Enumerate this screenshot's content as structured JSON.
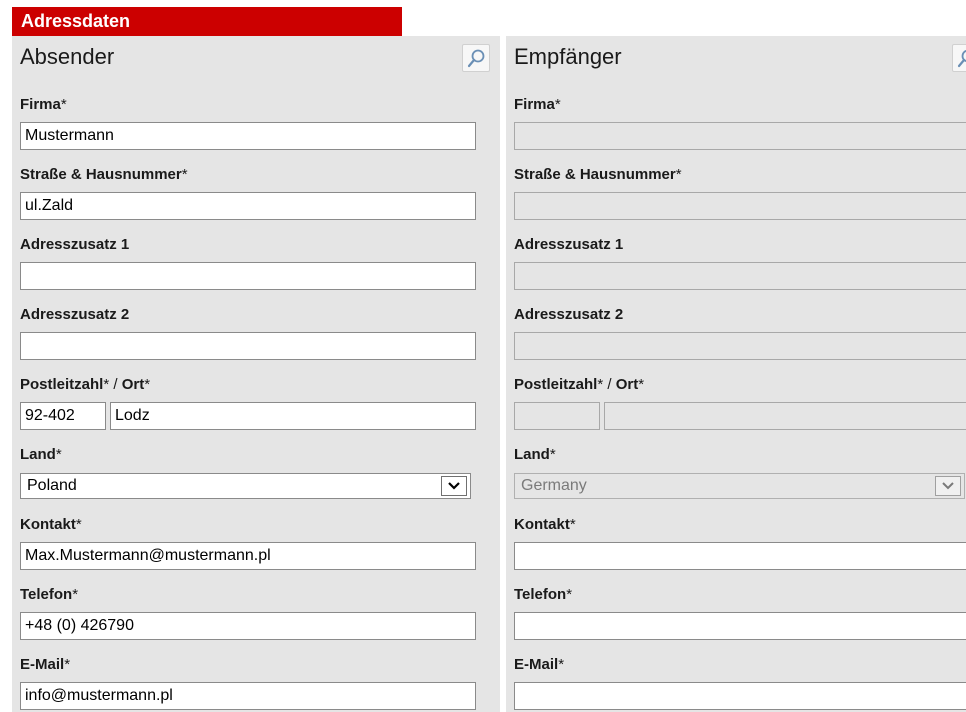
{
  "section_title": "Adressdaten",
  "sender": {
    "title": "Absender",
    "firma_label": "Firma",
    "firma_value": "Mustermann",
    "street_label": "Straße & Hausnummer",
    "street_value": "ul.Zald",
    "addr1_label": "Adresszusatz 1",
    "addr1_value": "",
    "addr2_label": "Adresszusatz 2",
    "addr2_value": "",
    "plz_label": "Postleitzahl",
    "ort_label": "Ort",
    "plz_value": "92-402",
    "ort_value": "Lodz",
    "land_label": "Land",
    "land_value": "Poland",
    "contact_label": "Kontakt",
    "contact_value": "Max.Mustermann@mustermann.pl",
    "phone_label": "Telefon",
    "phone_value": "+48 (0) 426790",
    "email_label": "E-Mail",
    "email_value": "info@mustermann.pl"
  },
  "recipient": {
    "title": "Empfänger",
    "firma_label": "Firma",
    "firma_value": "",
    "street_label": "Straße & Hausnummer",
    "street_value": "",
    "addr1_label": "Adresszusatz 1",
    "addr1_value": "",
    "addr2_label": "Adresszusatz 2",
    "addr2_value": "",
    "plz_label": "Postleitzahl",
    "ort_label": "Ort",
    "plz_value": "",
    "ort_value": "",
    "land_label": "Land",
    "land_value": "Germany",
    "contact_label": "Kontakt",
    "contact_value": "",
    "phone_label": "Telefon",
    "phone_value": "",
    "email_label": "E-Mail",
    "email_value": ""
  },
  "required_marker": "*",
  "separator": " / ",
  "icons": {
    "lookup": "magnifier-icon",
    "dropdown": "chevron-down-icon"
  },
  "colors": {
    "header_bg": "#cc0000",
    "panel_bg": "#e5e5e5"
  }
}
